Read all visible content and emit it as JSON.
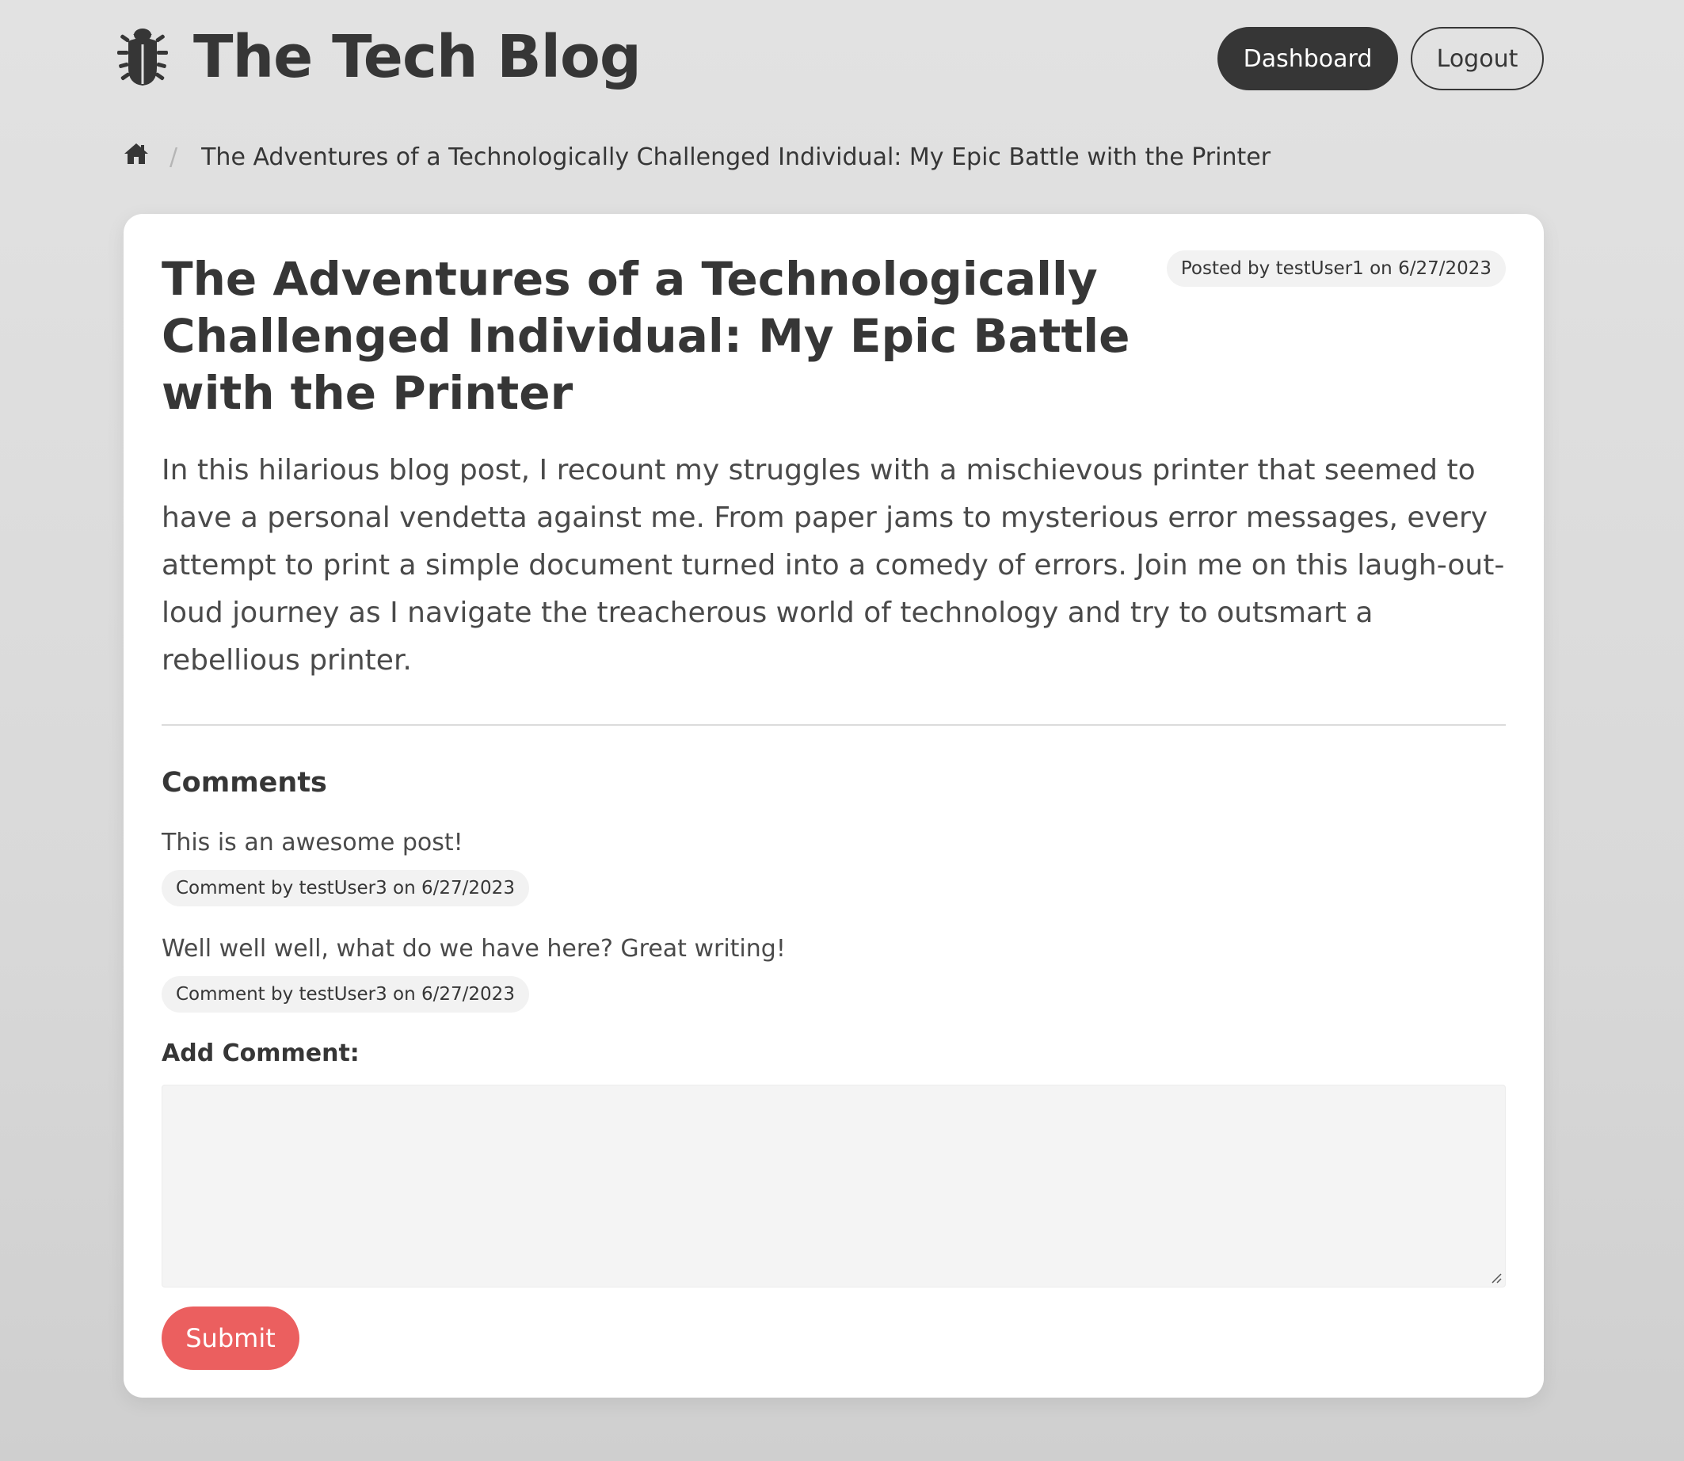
{
  "header": {
    "brand_title": "The Tech Blog",
    "brand_icon": "bug-icon",
    "dashboard_label": "Dashboard",
    "logout_label": "Logout"
  },
  "breadcrumb": {
    "home_icon": "home-icon",
    "separator": "/",
    "current": "The Adventures of a Technologically Challenged Individual: My Epic Battle with the Printer"
  },
  "post": {
    "title": "The Adventures of a Technologically Challenged Individual: My Epic Battle with the Printer",
    "meta": "Posted by testUser1 on 6/27/2023",
    "body": "In this hilarious blog post, I recount my struggles with a mischievous printer that seemed to have a personal vendetta against me. From paper jams to mysterious error messages, every attempt to print a simple document turned into a comedy of errors. Join me on this laugh-out-loud journey as I navigate the treacherous world of technology and try to outsmart a rebellious printer."
  },
  "comments": {
    "heading": "Comments",
    "items": [
      {
        "text": "This is an awesome post!",
        "meta": "Comment by testUser3 on 6/27/2023"
      },
      {
        "text": "Well well well, what do we have here? Great writing!",
        "meta": "Comment by testUser3 on 6/27/2023"
      }
    ]
  },
  "add_comment": {
    "label": "Add Comment:",
    "value": "",
    "submit_label": "Submit"
  },
  "colors": {
    "dark": "#363636",
    "accent": "#eb5f5f",
    "tag_bg": "#f2f2f2"
  }
}
